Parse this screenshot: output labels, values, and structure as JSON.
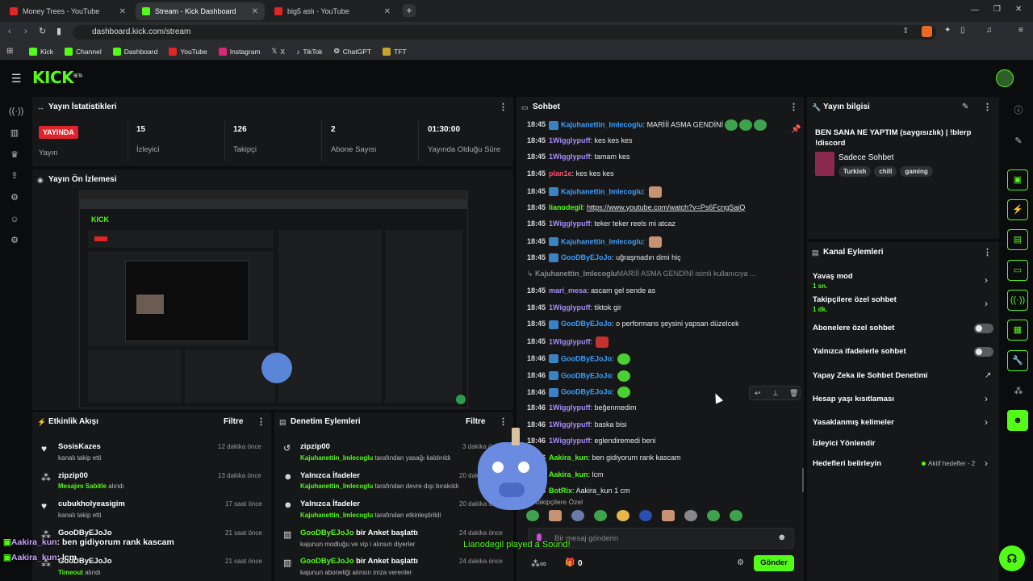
{
  "browser": {
    "tabs": [
      {
        "label": "Money Trees - YouTube",
        "color": "#e12626"
      },
      {
        "label": "Stream - Kick Dashboard",
        "color": "#53fc18"
      },
      {
        "label": "big5 aslı - YouTube",
        "color": "#e12626"
      }
    ],
    "url": "dashboard.kick.com/stream",
    "bookmarks": [
      "Kick",
      "Channel",
      "Dashboard",
      "YouTube",
      "Instagram",
      "X",
      "TikTok",
      "ChatGPT",
      "TFT"
    ]
  },
  "header": {
    "logo": "KICK",
    "beta": "BETA"
  },
  "stats": {
    "title": "Yayın İstatistikleri",
    "live_badge": "YAYINDA",
    "live_label": "Yayın",
    "items": [
      {
        "value": "15",
        "label": "İzleyici"
      },
      {
        "value": "126",
        "label": "Takipçi"
      },
      {
        "value": "2",
        "label": "Abone Sayısı"
      },
      {
        "value": "01:30:00",
        "label": "Yayında Olduğu Süre"
      }
    ]
  },
  "preview": {
    "title": "Yayın Ön İzlemesi"
  },
  "activity": {
    "title": "Etkinlik Akışı",
    "filter": "Filtre",
    "items": [
      {
        "name": "SosisKazes",
        "desc": "kanalı takip etti",
        "time": "12 dakika önce"
      },
      {
        "name": "zipzip00",
        "desc_green": "Mesajını Sabitle",
        "desc": " alındı",
        "time": "13 dakika önce"
      },
      {
        "name": "cubukholyeasigim",
        "desc": "kanalı takip etti",
        "time": "17 saat önce"
      },
      {
        "name": "GooDByEJoJo",
        "desc": "",
        "time": "21 saat önce"
      },
      {
        "name": "GooDByEJoJo",
        "desc_green": "Timeout",
        "desc": " alındı",
        "time": "21 saat önce"
      }
    ]
  },
  "moderation": {
    "title": "Denetim Eylemleri",
    "filter": "Filtre",
    "items": [
      {
        "name": "zipzip00",
        "actor": "Kajuhanettin_Imlecoglu",
        "desc": " tarafından yasağı kaldırıldı",
        "time": "3 dakika önce"
      },
      {
        "name": "Yalnızca İfadeler",
        "actor": "Kajuhanettin_Imlecoglu",
        "desc": " tarafından devre dışı bırakıldı",
        "time": "20 dakika önce"
      },
      {
        "name": "Yalnızca İfadeler",
        "actor": "Kajuhanettin_Imlecoglu",
        "desc": " tarafından etkinleştirildi",
        "time": "20 dakika önce"
      },
      {
        "name_green": "GooDByEJoJo",
        "name": " bir Anket başlattı",
        "desc": "kajunun modluğu ve vip i alınsın diyerler",
        "time": "24 dakika önce"
      },
      {
        "name_green": "GooDByEJoJo",
        "name": " bir Anket başlattı",
        "desc": "kajunun aboneliği alınsın imza verenler",
        "time": "24 dakika önce"
      }
    ]
  },
  "chat": {
    "title": "Sohbet",
    "messages": [
      {
        "time": "18:45",
        "user": "Kajuhanettin_Imlecoglu",
        "color": "#3aa0ff",
        "text": "MARİİİ ASMA GENDİNİ",
        "emotes": 3
      },
      {
        "time": "18:45",
        "user": "1Wigglypuff",
        "color": "#a78bfa",
        "text": "kes kes kes"
      },
      {
        "time": "18:45",
        "user": "1Wigglypuff",
        "color": "#a78bfa",
        "text": "tamam kes"
      },
      {
        "time": "18:45",
        "user": "plan1e",
        "color": "#ff4d6d",
        "text": "kes kes kes"
      },
      {
        "time": "18:45",
        "user": "Kajuhanettin_Imlecoglu",
        "color": "#3aa0ff",
        "text": "",
        "emotes": 1
      },
      {
        "time": "18:45",
        "user": "lianodegil",
        "color": "#53fc18",
        "text": "https://www.youtube.com/watch?v=Ps6FcngSaiQ"
      },
      {
        "time": "18:45",
        "user": "1Wigglypuff",
        "color": "#a78bfa",
        "text": "teker teker reels mi atcaz"
      },
      {
        "time": "18:45",
        "user": "Kajuhanettin_Imlecoglu",
        "color": "#3aa0ff",
        "text": "",
        "emotes": 1
      },
      {
        "time": "18:45",
        "user": "GooDByEJoJo",
        "color": "#3aa0ff",
        "text": "uğraşmadın dimi hiç"
      },
      {
        "time": "",
        "user": "Kajuhanettin_Imlecoglu",
        "color": "#888",
        "text": "MARİİİ ASMA GENDİNİ  isimli kullanıcıya ..."
      },
      {
        "time": "18:45",
        "user": "mari_mesa",
        "color": "#a78bfa",
        "text": "ascam gel sende as"
      },
      {
        "time": "18:45",
        "user": "1Wigglypuff",
        "color": "#a78bfa",
        "text": "tiktok gir"
      },
      {
        "time": "18:45",
        "user": "GooDByEJoJo",
        "color": "#3aa0ff",
        "text": "o performans şeysini yapsan düzelcek"
      },
      {
        "time": "18:45",
        "user": "1Wigglypuff",
        "color": "#a78bfa",
        "text": "",
        "emotes": 1
      },
      {
        "time": "18:46",
        "user": "GooDByEJoJo",
        "color": "#3aa0ff",
        "text": "",
        "emotes": 1
      },
      {
        "time": "18:46",
        "user": "GooDByEJoJo",
        "color": "#3aa0ff",
        "text": "",
        "emotes": 1
      },
      {
        "time": "18:46",
        "user": "GooDByEJoJo",
        "color": "#3aa0ff",
        "text": "",
        "emotes": 1
      },
      {
        "time": "18:46",
        "user": "1Wigglypuff",
        "color": "#a78bfa",
        "text": "beğenmedim"
      },
      {
        "time": "18:46",
        "user": "1Wigglypuff",
        "color": "#a78bfa",
        "text": "baska bisi"
      },
      {
        "time": "18:46",
        "user": "1Wigglypuff",
        "color": "#a78bfa",
        "text": "eglendiremedi beni"
      },
      {
        "time": "18:46",
        "user": "Aakira_kun",
        "color": "#53fc18",
        "text": "ben gidiyorum rank kascam"
      },
      {
        "time": "18:46",
        "user": "Aakira_kun",
        "color": "#53fc18",
        "text": "lcm"
      },
      {
        "time": "18:46",
        "user": "BotRix",
        "color": "#53fc18",
        "text": "Aakira_kun 1 cm"
      }
    ],
    "followers_only": "Takipçilere Özel",
    "placeholder": "Bir mesaj gönderin",
    "count": "0",
    "send": "Gönder"
  },
  "stream_info": {
    "title": "Yayın bilgisi",
    "stream_title": "BEN SANA NE YAPTIM (saygısızlık) | !blerp !discord",
    "category": "Sadece Sohbet",
    "tags": [
      "Turkish",
      "chill",
      "gaming"
    ]
  },
  "channel_actions": {
    "title": "Kanal Eylemleri",
    "items": [
      {
        "label": "Yavaş mod",
        "sub": "1 sn."
      },
      {
        "label": "Takipçilere özel sohbet",
        "sub": "1 dk."
      },
      {
        "label": "Abonelere özel sohbet"
      },
      {
        "label": "Yalnızca ifadelerle sohbet"
      },
      {
        "label": "Yapay Zeka ile Sohbet Denetimi"
      },
      {
        "label": "Hesap yaşı kısıtlaması"
      },
      {
        "label": "Yasaklanmış kelimeler"
      },
      {
        "label": "İzleyici Yönlendir"
      },
      {
        "label": "Hedefleri belirleyin",
        "sub": "Aktif hedefler - 2"
      }
    ]
  },
  "overlay": {
    "chat1_user": "Aakira_kun",
    "chat1_text": ": ben gidiyorum rank kascam",
    "chat2_user": "Aakira_kun",
    "chat2_text": ": lcm",
    "sound": "Lianodegil played a Sound!"
  }
}
